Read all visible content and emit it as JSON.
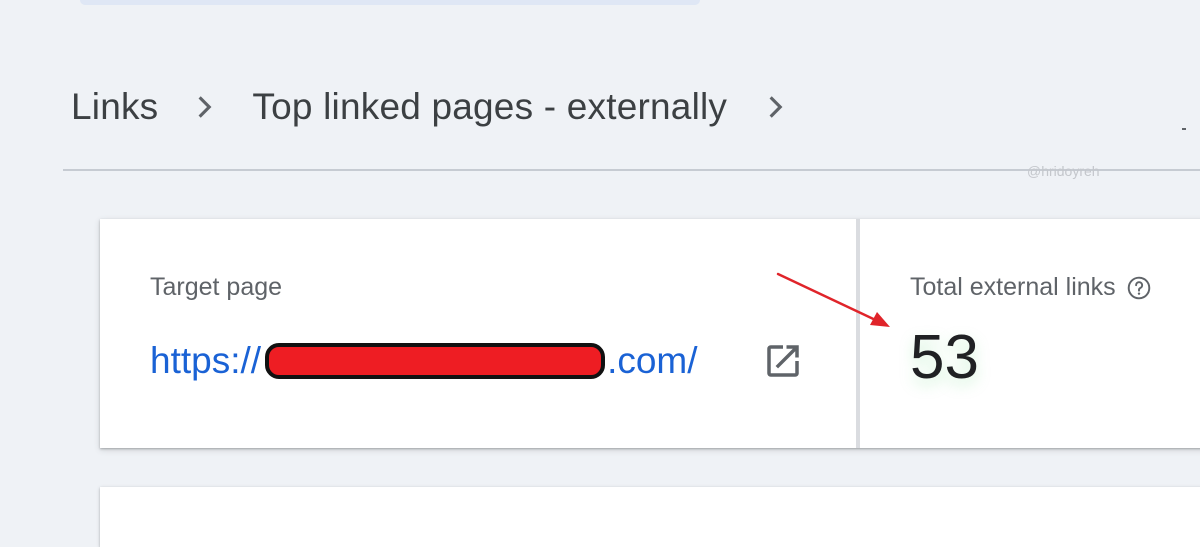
{
  "breadcrumb": {
    "items": [
      {
        "label": "Links"
      },
      {
        "label": "Top linked pages - externally"
      }
    ]
  },
  "watermark": "@hridoyreh",
  "summary_card": {
    "target_page": {
      "label": "Target page",
      "url_prefix": "https://",
      "url_suffix": ".com/"
    },
    "total_external_links": {
      "label": "Total external links",
      "value": "53"
    }
  },
  "icons": {
    "breadcrumb_separator": "chevron-right-icon",
    "open_link": "open-in-new-icon",
    "help": "help-icon"
  },
  "colors": {
    "link": "#1a62d5",
    "redaction": "#ee1d23",
    "annotation_arrow": "#e0242a"
  }
}
